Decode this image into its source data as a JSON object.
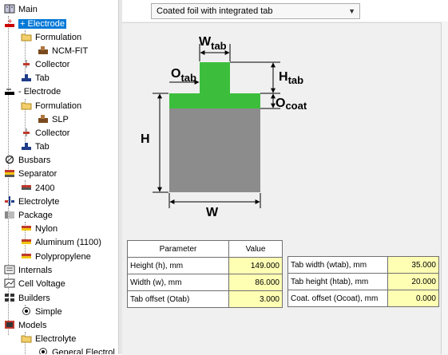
{
  "tree": {
    "items": [
      {
        "label": "Main",
        "icon": "book-icon"
      },
      {
        "label": "+ Electrode",
        "icon": "positive-electrode-icon"
      },
      {
        "label": "Formulation",
        "icon": "folder-icon"
      },
      {
        "label": "NCM-FIT",
        "icon": "material-icon"
      },
      {
        "label": "Collector",
        "icon": "collector-icon"
      },
      {
        "label": "Tab",
        "icon": "tab-icon"
      },
      {
        "label": "- Electrode",
        "icon": "negative-electrode-icon"
      },
      {
        "label": "Formulation",
        "icon": "folder-icon"
      },
      {
        "label": "SLP",
        "icon": "material-icon"
      },
      {
        "label": "Collector",
        "icon": "collector-icon"
      },
      {
        "label": "Tab",
        "icon": "tab-icon"
      },
      {
        "label": "Busbars",
        "icon": "busbar-icon"
      },
      {
        "label": "Separator",
        "icon": "separator-icon"
      },
      {
        "label": "2400",
        "icon": "separator-item-icon"
      },
      {
        "label": "Electrolyte",
        "icon": "electrolyte-icon"
      },
      {
        "label": "Package",
        "icon": "package-icon"
      },
      {
        "label": "Nylon",
        "icon": "package-layer-icon"
      },
      {
        "label": "Aluminum (1100)",
        "icon": "package-layer-icon"
      },
      {
        "label": "Polypropylene",
        "icon": "package-layer-icon"
      },
      {
        "label": "Internals",
        "icon": "internals-icon"
      },
      {
        "label": "Cell Voltage",
        "icon": "voltage-icon"
      },
      {
        "label": "Builders",
        "icon": "builders-icon"
      },
      {
        "label": "Simple",
        "icon": "radio-selected-icon"
      },
      {
        "label": "Models",
        "icon": "models-icon"
      },
      {
        "label": "Electrolyte",
        "icon": "folder-icon"
      },
      {
        "label": "General Electrol",
        "icon": "radio-selected-icon"
      }
    ]
  },
  "dropdown": {
    "value": "Coated foil with integrated tab"
  },
  "diagram": {
    "labels": {
      "wtab_main": "W",
      "wtab_sub": "tab",
      "otab_main": "O",
      "otab_sub": "tab",
      "htab_main": "H",
      "htab_sub": "tab",
      "ocoat_main": "O",
      "ocoat_sub": "coat",
      "h": "H",
      "w": "W"
    },
    "colors": {
      "coating": "#3cbe3c",
      "tab": "#3cbe3c",
      "foil": "#8c8c8c"
    }
  },
  "table_left": {
    "headers": [
      "Parameter",
      "Value"
    ],
    "rows": [
      {
        "label": "Height (h), mm",
        "value": "149.000"
      },
      {
        "label": "Width (w), mm",
        "value": "86.000"
      },
      {
        "label": "Tab offset (Otab)",
        "value": "3.000"
      }
    ]
  },
  "table_right": {
    "rows": [
      {
        "label": "Tab width (wtab), mm",
        "value": "35.000"
      },
      {
        "label": "Tab height (htab), mm",
        "value": "20.000"
      },
      {
        "label": "Coat. offset (Ocoat), mm",
        "value": "0.000"
      }
    ]
  }
}
